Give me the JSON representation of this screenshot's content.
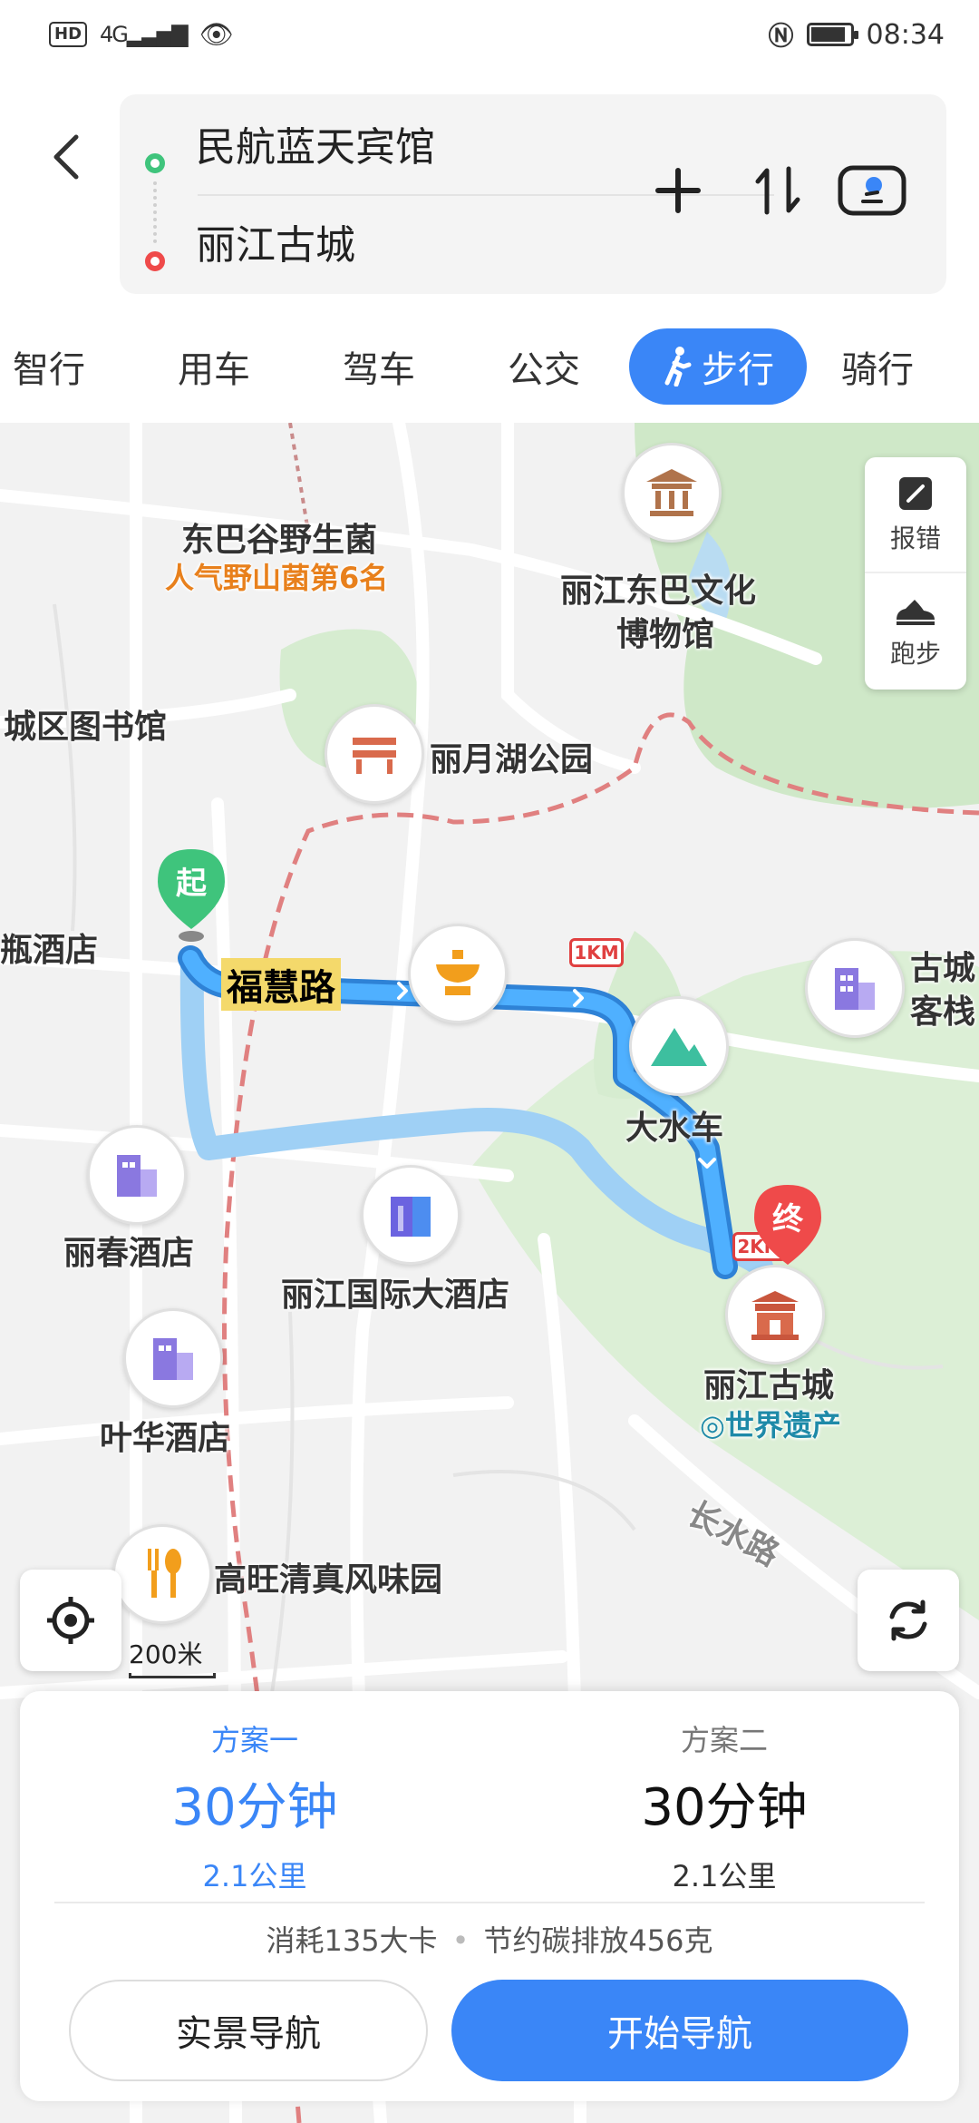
{
  "status_bar": {
    "hd": "HD",
    "network": "4G+",
    "time": "08:34",
    "battery_level": 0.85
  },
  "route": {
    "from": "民航蓝天宾馆",
    "to": "丽江古城"
  },
  "icons": {
    "back": "back-arrow-icon",
    "add": "plus-icon",
    "swap": "swap-icon",
    "voice": "voice-icon"
  },
  "tabs": [
    {
      "label": "智行"
    },
    {
      "label": "用车"
    },
    {
      "label": "驾车"
    },
    {
      "label": "公交"
    },
    {
      "label": "步行",
      "active": true
    },
    {
      "label": "骑行"
    }
  ],
  "map": {
    "side_tools": {
      "report": "报错",
      "run": "跑步"
    },
    "labels": {
      "dongba_mushroom": "东巴谷野生菌",
      "dongba_mushroom_sub": "人气野山菌第6名",
      "museum": "丽江东巴文化",
      "museum2": "博物馆",
      "library": "城区图书馆",
      "liyue_park": "丽月湖公园",
      "hotel_left": "瓶酒店",
      "old_town_inn": "古城",
      "old_town_inn2": "客栈",
      "dashuiche": "大水车",
      "lichun_hotel": "丽春酒店",
      "intl_hotel": "丽江国际大酒店",
      "yehua_hotel": "叶华酒店",
      "old_town": "丽江古城",
      "world_heritage": "世界遗产",
      "changshui_road": "长水路",
      "gaowang": "高旺清真风味园",
      "street": "福慧路",
      "km1": "1KM",
      "km2": "2KM",
      "start_pin": "起",
      "end_pin": "终"
    },
    "scale": "200米"
  },
  "plans": [
    {
      "name": "方案一",
      "time": "30分钟",
      "distance": "2.1公里"
    },
    {
      "name": "方案二",
      "time": "30分钟",
      "distance": "2.1公里"
    }
  ],
  "stats": {
    "calories": "消耗135大卡",
    "carbon": "节约碳排放456克"
  },
  "buttons": {
    "ar_nav": "实景导航",
    "start_nav": "开始导航"
  },
  "colors": {
    "accent": "#3a86f7",
    "route_main": "#3d9be9",
    "route_alt": "#9fd0f5",
    "park": "#cfe8c8",
    "start_pin": "#3fc47c",
    "end_pin": "#ef4a4a"
  }
}
